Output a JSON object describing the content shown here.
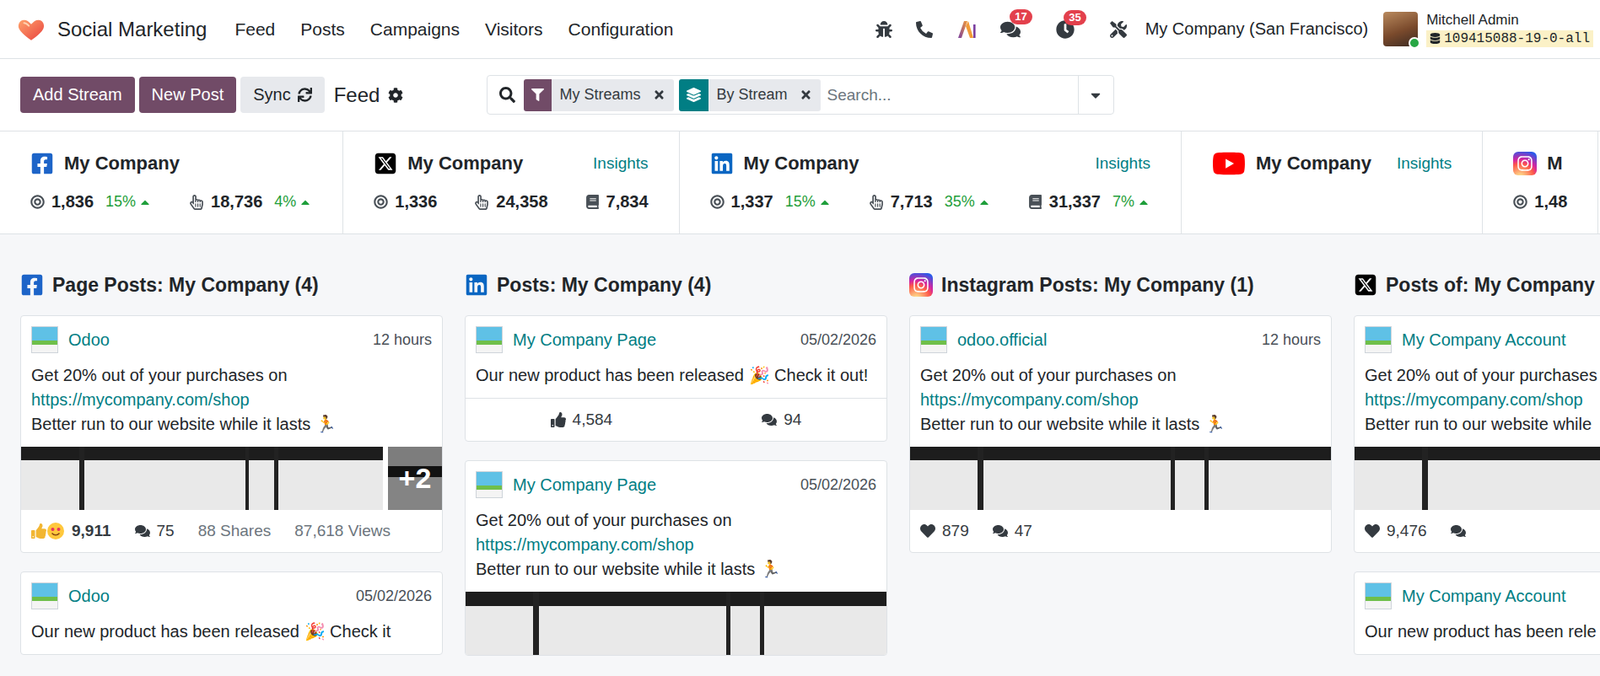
{
  "navbar": {
    "app_name": "Social Marketing",
    "menu": [
      "Feed",
      "Posts",
      "Campaigns",
      "Visitors",
      "Configuration"
    ],
    "messages_badge": "17",
    "activities_badge": "35",
    "company": "My Company (San Francisco)",
    "user": {
      "name": "Mitchell Admin",
      "database": "109415088-19-0-all",
      "online": true
    }
  },
  "control_panel": {
    "buttons": [
      {
        "label": "Add Stream",
        "kind": "primary"
      },
      {
        "label": "New Post",
        "kind": "primary"
      },
      {
        "label": "Sync",
        "kind": "sync"
      }
    ],
    "title": "Feed",
    "search": {
      "facets": [
        {
          "label": "My Streams",
          "kind": "filter"
        },
        {
          "label": "By Stream",
          "kind": "group"
        }
      ],
      "placeholder": "Search..."
    }
  },
  "accounts": [
    {
      "kind": "facebook",
      "name": "My Company",
      "stats": [
        {
          "kind": "audience",
          "value": "1,836",
          "trend": "15%",
          "trend_up": true
        },
        {
          "kind": "engagement",
          "value": "18,736",
          "trend": "4%",
          "trend_up": true
        }
      ]
    },
    {
      "kind": "x",
      "name": "My Company",
      "insights": "Insights",
      "stats": [
        {
          "kind": "audience",
          "value": "1,336"
        },
        {
          "kind": "engagement",
          "value": "24,358"
        },
        {
          "kind": "stories",
          "value": "7,834"
        }
      ]
    },
    {
      "kind": "linkedin",
      "name": "My Company",
      "insights": "Insights",
      "stats": [
        {
          "kind": "audience",
          "value": "1,337",
          "trend": "15%",
          "trend_up": true
        },
        {
          "kind": "engagement",
          "value": "7,713",
          "trend": "35%",
          "trend_up": true
        },
        {
          "kind": "stories",
          "value": "31,337",
          "trend": "7%",
          "trend_up": true
        }
      ]
    },
    {
      "kind": "youtube",
      "name": "My Company",
      "insights": "Insights",
      "stats": []
    },
    {
      "kind": "instagram",
      "name": "M",
      "stats": [
        {
          "kind": "audience",
          "value": "1,48"
        }
      ]
    }
  ],
  "streams": [
    {
      "kind": "facebook",
      "title": "Page Posts: My Company (4)",
      "posts": [
        {
          "author": "Odoo",
          "time": "12 hours",
          "lines": [
            {
              "text": "Get 20% out of your purchases on",
              "kind": "text"
            },
            {
              "text": "https://mycompany.com/shop",
              "kind": "link"
            },
            {
              "text": "Better run to our website while it lasts 🏃",
              "kind": "text"
            }
          ],
          "media": {
            "kind": "gallery",
            "more": "+2"
          },
          "stats": [
            {
              "kind": "reactions",
              "value": "9,911"
            },
            {
              "kind": "comments",
              "value": "75"
            },
            {
              "kind": "shares",
              "value": "88 Shares"
            },
            {
              "kind": "views",
              "value": "87,618 Views"
            }
          ]
        },
        {
          "author": "Odoo",
          "time": "05/02/2026",
          "lines": [
            {
              "text": "Our new product has been released 🎉 Check it",
              "kind": "text"
            }
          ],
          "stats": []
        }
      ]
    },
    {
      "kind": "linkedin",
      "title": "Posts: My Company (4)",
      "posts": [
        {
          "author": "My Company Page",
          "time": "05/02/2026",
          "lines": [
            {
              "text": "Our new product has been released 🎉 Check it out!",
              "kind": "text"
            }
          ],
          "stats": [
            {
              "kind": "likes",
              "value": "4,584"
            },
            {
              "kind": "comments",
              "value": "94"
            }
          ]
        },
        {
          "author": "My Company Page",
          "time": "05/02/2026",
          "lines": [
            {
              "text": "Get 20% out of your purchases on",
              "kind": "text"
            },
            {
              "text": "https://mycompany.com/shop",
              "kind": "link"
            },
            {
              "text": "Better run to our website while it lasts 🏃",
              "kind": "text"
            }
          ],
          "media": {
            "kind": "single"
          },
          "stats": []
        }
      ]
    },
    {
      "kind": "instagram",
      "title": "Instagram Posts: My Company (1)",
      "posts": [
        {
          "author": "odoo.official",
          "time": "12 hours",
          "lines": [
            {
              "text": "Get 20% out of your purchases on",
              "kind": "text"
            },
            {
              "text": "https://mycompany.com/shop",
              "kind": "link"
            },
            {
              "text": "Better run to our website while it lasts 🏃",
              "kind": "text"
            }
          ],
          "media": {
            "kind": "single"
          },
          "stats": [
            {
              "kind": "likes",
              "value": "879"
            },
            {
              "kind": "comments",
              "value": "47"
            }
          ]
        }
      ]
    },
    {
      "kind": "x",
      "title": "Posts of: My Company",
      "posts": [
        {
          "author": "My Company Account",
          "lines": [
            {
              "text": "Get 20% out of your purchases",
              "kind": "text"
            },
            {
              "text": "https://mycompany.com/shop",
              "kind": "link"
            },
            {
              "text": "Better run to our website while",
              "kind": "text"
            }
          ],
          "media": {
            "kind": "single"
          },
          "stats": [
            {
              "kind": "likes",
              "value": "9,476"
            },
            {
              "kind": "comments"
            }
          ]
        },
        {
          "author": "My Company Account",
          "lines": [
            {
              "text": "Our new product has been rele",
              "kind": "text"
            }
          ],
          "stats": []
        }
      ]
    }
  ]
}
